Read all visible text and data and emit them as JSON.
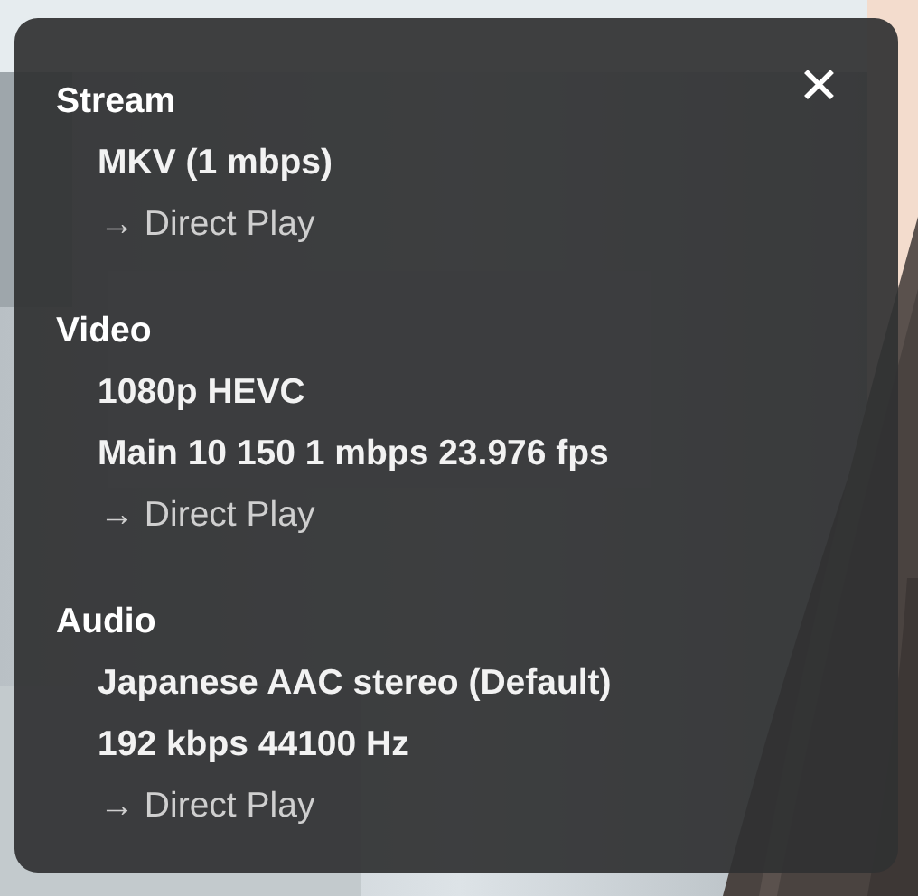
{
  "panel": {
    "close": "✕",
    "sections": [
      {
        "title": "Stream",
        "items": [
          {
            "kind": "value",
            "text": "MKV (1 mbps)"
          },
          {
            "kind": "decision",
            "text": "→ Direct Play"
          }
        ]
      },
      {
        "title": "Video",
        "items": [
          {
            "kind": "value",
            "text": "1080p HEVC"
          },
          {
            "kind": "value",
            "text": "Main 10 150 1 mbps 23.976 fps"
          },
          {
            "kind": "decision",
            "text": "→ Direct Play"
          }
        ]
      },
      {
        "title": "Audio",
        "items": [
          {
            "kind": "value",
            "text": "Japanese AAC stereo (Default)"
          },
          {
            "kind": "value",
            "text": "192 kbps 44100 Hz"
          },
          {
            "kind": "decision",
            "text": "→ Direct Play"
          }
        ]
      }
    ]
  }
}
